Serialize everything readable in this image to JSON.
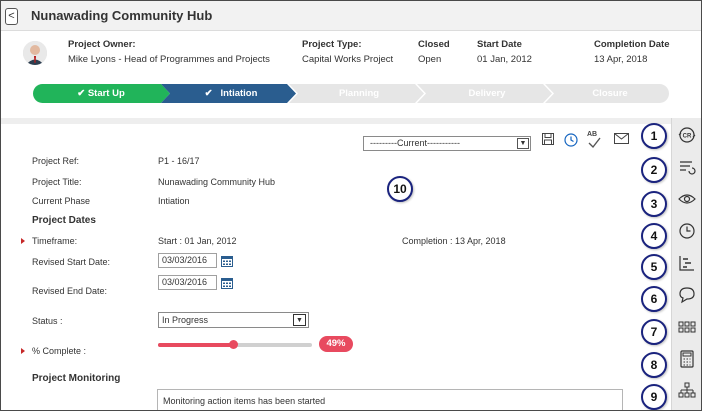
{
  "header": {
    "back_glyph": "<",
    "title": "Nunawading Community Hub"
  },
  "project": {
    "owner_label": "Project Owner:",
    "owner_value": "Mike Lyons - Head of Programmes and Projects",
    "type_label": "Project Type:",
    "type_value": "Capital Works Project",
    "status_label": "Closed",
    "status_value": "Open",
    "start_label": "Start Date",
    "start_value": "01 Jan, 2012",
    "completion_label": "Completion Date",
    "completion_value": "13 Apr, 2018"
  },
  "stepper": {
    "steps": [
      {
        "label": "Start Up",
        "state": "done"
      },
      {
        "label": "Intiation",
        "state": "current"
      },
      {
        "label": "Planning",
        "state": "upcoming"
      },
      {
        "label": "Delivery",
        "state": "upcoming"
      },
      {
        "label": "Closure",
        "state": "upcoming"
      }
    ],
    "check_glyph": "✔",
    "colors": {
      "done": "#21b45a",
      "current": "#2a5d8f",
      "upcoming": "#e6e6e6"
    }
  },
  "toolbar": {
    "snapshot_value": "---------Current-----------",
    "dropdown_glyph": "▼",
    "spell_glyph": "AB"
  },
  "form": {
    "ref_label": "Project Ref:",
    "ref_value": "P1 - 16/17",
    "title_label": "Project Title:",
    "title_value": "Nunawading Community Hub",
    "phase_label": "Current Phase",
    "phase_value": "Intiation",
    "dates_section": "Project Dates",
    "timeframe_label": "Timeframe:",
    "timeframe_start": "Start : 01 Jan, 2012",
    "timeframe_completion": "Completion : 13 Apr, 2018",
    "revised_start_label": "Revised Start Date:",
    "revised_start_value": "03/03/2016",
    "revised_end_label": "Revised End Date:",
    "revised_end_value": "03/03/2016",
    "status_label": "Status :",
    "status_value": "In Progress",
    "complete_label": "% Complete :",
    "complete_value": 49,
    "complete_text": "49%",
    "monitoring_section": "Project Monitoring",
    "monitoring_text": "Monitoring action items has been started"
  },
  "sidebar_icons": [
    "change-request-icon",
    "list-refresh-icon",
    "eye-icon",
    "clock-icon",
    "gantt-icon",
    "comment-icon",
    "grid-icon",
    "calculator-icon",
    "org-chart-icon"
  ],
  "callouts": [
    "1",
    "2",
    "3",
    "4",
    "5",
    "6",
    "7",
    "8",
    "9",
    "10"
  ],
  "accent": "#e84a5f"
}
